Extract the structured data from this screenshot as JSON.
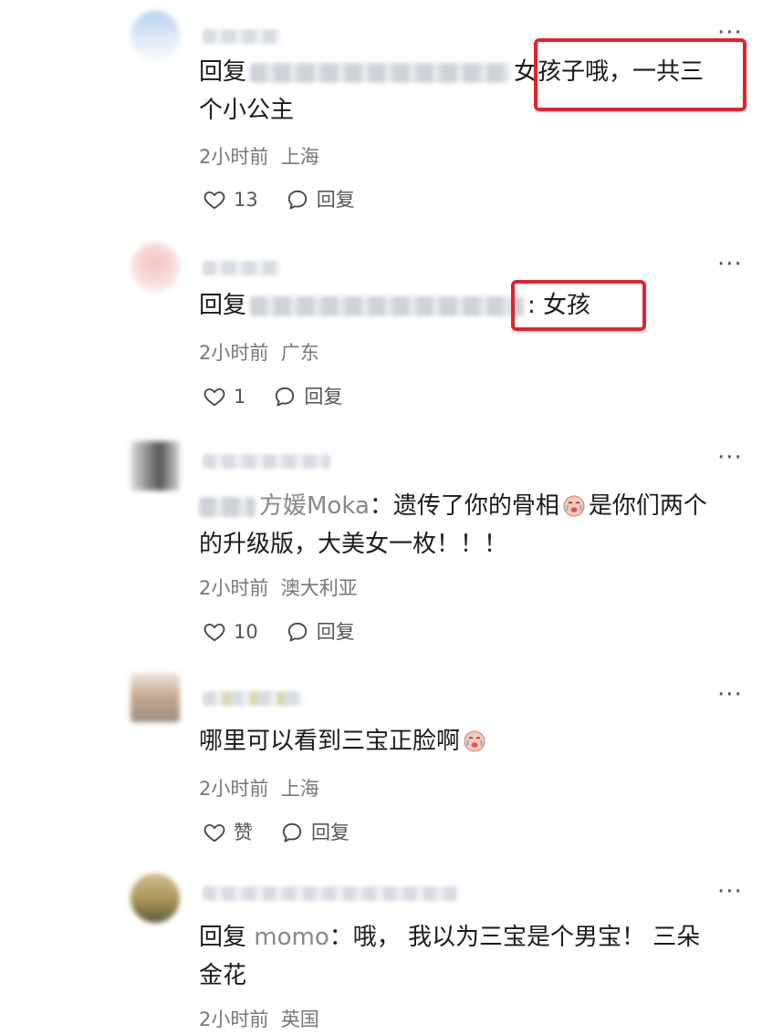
{
  "comments": [
    {
      "reply_prefix": "回复",
      "text_line1": "女孩子哦，一共三",
      "text_line2": "个小公主",
      "time": "2小时前",
      "location": "上海",
      "likes": "13",
      "reply_label": "回复",
      "more": "···"
    },
    {
      "reply_prefix": "回复",
      "text_line1": ": 女孩",
      "time": "2小时前",
      "location": "广东",
      "likes": "1",
      "reply_label": "回复",
      "more": "···"
    },
    {
      "reply_to": "方媛Moka",
      "text_line1": "：遗传了你的骨相",
      "text_line1b": "是你们两个",
      "text_line2": "的升级版，大美女一枚！！！",
      "time": "2小时前",
      "location": "澳大利亚",
      "likes": "10",
      "reply_label": "回复",
      "more": "···"
    },
    {
      "text_line1": "哪里可以看到三宝正脸啊",
      "time": "2小时前",
      "location": "上海",
      "likes": "赞",
      "reply_label": "回复",
      "more": "···"
    },
    {
      "reply_prefix": "回复",
      "reply_to": "momo",
      "text_line1": "：哦， 我以为三宝是个男宝！ 三朵",
      "text_line2": "金花",
      "time": "2小时前",
      "location": "英国",
      "more": "···"
    }
  ],
  "colors": {
    "highlight_box": "#e8202a",
    "meta": "#777777",
    "name": "#888888"
  },
  "icons": {
    "like": "heart-outline-icon",
    "reply": "speech-bubble-icon",
    "more": "more-dots-icon"
  }
}
